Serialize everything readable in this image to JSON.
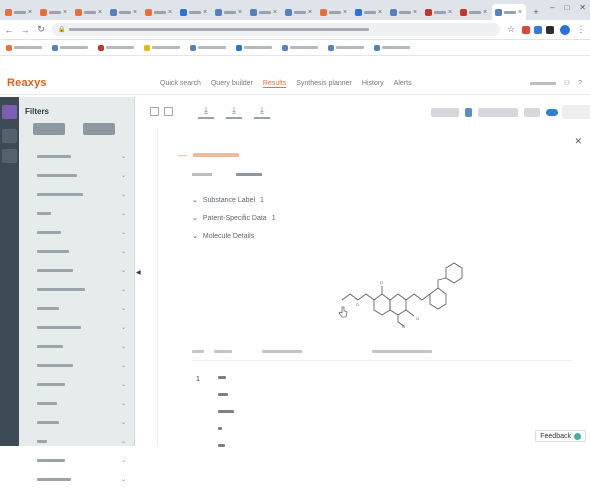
{
  "browser": {
    "tabs": [
      {
        "color": "#e8703a",
        "active": false
      },
      {
        "color": "#e8703a",
        "active": false
      },
      {
        "color": "#e8703a",
        "active": false
      },
      {
        "color": "#5a7fbf",
        "active": false
      },
      {
        "color": "#e8703a",
        "active": false
      },
      {
        "color": "#2b73d9",
        "active": false
      },
      {
        "color": "#5a7fbf",
        "active": false
      },
      {
        "color": "#5a7fbf",
        "active": false
      },
      {
        "color": "#5a7fbf",
        "active": false
      },
      {
        "color": "#e8703a",
        "active": false
      },
      {
        "color": "#2b73d9",
        "active": false
      },
      {
        "color": "#5a7fbf",
        "active": false
      },
      {
        "color": "#c0392b",
        "active": false
      },
      {
        "color": "#c0392b",
        "active": false
      },
      {
        "color": "#5a7fbf",
        "active": true
      }
    ],
    "bookmarks": [
      {
        "color": "#e8703a"
      },
      {
        "color": "#5a7fbf"
      },
      {
        "color": "#c0392b"
      },
      {
        "color": "#e6b800"
      },
      {
        "color": "#5a7fbf"
      },
      {
        "color": "#2b73d9"
      },
      {
        "color": "#5a7fbf"
      },
      {
        "color": "#5a7fbf"
      },
      {
        "color": "#5a7fbf"
      }
    ],
    "extension_colors": [
      "#e0453a",
      "#3a78d6",
      "#2d2d2d"
    ]
  },
  "app": {
    "logo": "Reaxys",
    "brand_color": "#e35f16",
    "nav_items": [
      {
        "label": "Quick search",
        "active": false
      },
      {
        "label": "Query builder",
        "active": false
      },
      {
        "label": "Results",
        "active": true
      },
      {
        "label": "Synthesis planner",
        "active": false
      },
      {
        "label": "History",
        "active": false
      },
      {
        "label": "Alerts",
        "active": false
      }
    ]
  },
  "filters": {
    "title": "Filters",
    "item_count": 18
  },
  "record": {
    "sections": [
      {
        "label": "Substance Label",
        "count": "1"
      },
      {
        "label": "Patent-Specific Data",
        "count": "1"
      },
      {
        "label": "Molecule Details",
        "count": ""
      }
    ],
    "row_index": "1"
  },
  "feedback": {
    "label": "Feedback"
  }
}
